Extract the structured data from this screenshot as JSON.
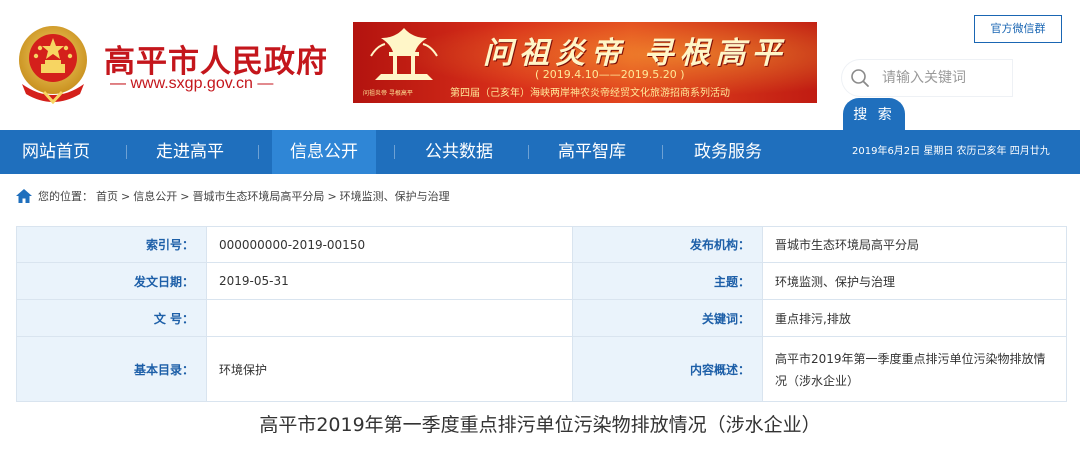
{
  "header": {
    "site_name": "高平市人民政府",
    "site_url": "www.sxgp.gov.cn",
    "wechat_label": "官方微信群",
    "search_placeholder": "请输入关键词",
    "search_button": "搜 索"
  },
  "banner": {
    "slogan": "问祖炎帝 寻根高平",
    "dates": "( 2019.4.10——2019.5.20 )",
    "subtitle": "第四届（己亥年）海峡两岸神农炎帝经贸文化旅游招商系列活动",
    "logo_caption": "问祖炎帝 寻根高平"
  },
  "nav": {
    "items": [
      {
        "label": "网站首页"
      },
      {
        "label": "走进高平"
      },
      {
        "label": "信息公开"
      },
      {
        "label": "公共数据"
      },
      {
        "label": "高平智库"
      },
      {
        "label": "政务服务"
      }
    ],
    "active_index": 2,
    "date_text": "2019年6月2日 星期日 农历己亥年 四月廿九"
  },
  "breadcrumb": {
    "prefix": "您的位置：",
    "items": [
      "首页",
      "信息公开",
      "晋城市生态环境局高平分局",
      "环境监测、保护与治理"
    ],
    "separator": ">"
  },
  "info": {
    "rows": [
      {
        "l1": "索引号：",
        "v1": "000000000-2019-00150",
        "l2": "发布机构：",
        "v2": "晋城市生态环境局高平分局"
      },
      {
        "l1": "发文日期：",
        "v1": "2019-05-31",
        "l2": "主题：",
        "v2": "环境监测、保护与治理"
      },
      {
        "l1": "文 号：",
        "v1": "",
        "l2": "关键词：",
        "v2": "重点排污,排放"
      },
      {
        "l1": "基本目录：",
        "v1": "环境保护",
        "l2": "内容概述：",
        "v2": "高平市2019年第一季度重点排污单位污染物排放情况（涉水企业）"
      }
    ]
  },
  "article": {
    "title": "高平市2019年第一季度重点排污单位污染物排放情况（涉水企业）"
  },
  "colors": {
    "brand_red": "#c4161c",
    "nav_blue": "#1f6fbd",
    "nav_active": "#2f86d6",
    "label_bg": "#eaf3fb",
    "label_text": "#1d5fa8"
  }
}
